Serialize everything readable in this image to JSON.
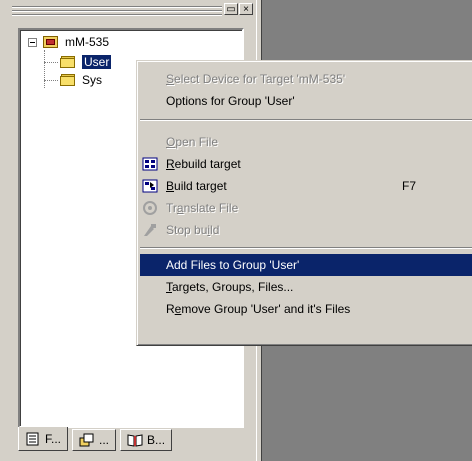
{
  "tree": {
    "root_label": "mM-535",
    "children": [
      {
        "label": "User",
        "selected": true
      },
      {
        "label": "Sys"
      }
    ]
  },
  "title_buttons": {
    "restore": "▭",
    "close": "×"
  },
  "tabs": [
    {
      "label": "F...",
      "icon": "files-icon"
    },
    {
      "label": "...",
      "icon": "regs-icon"
    },
    {
      "label": "B...",
      "icon": "books-icon"
    }
  ],
  "context_menu": {
    "items": [
      {
        "pre": "",
        "u": "S",
        "post": "elect Device for Target 'mM-535'",
        "accel": "",
        "enabled": false,
        "icon": ""
      },
      {
        "pre": "Options for Group 'User'",
        "u": "",
        "post": "",
        "accel": "",
        "enabled": true,
        "icon": ""
      },
      {
        "pre": "",
        "u": "O",
        "post": "pen File",
        "accel": "",
        "enabled": false,
        "icon": ""
      },
      {
        "pre": "",
        "u": "R",
        "post": "ebuild target",
        "accel": "",
        "enabled": true,
        "icon": "rebuild-icon"
      },
      {
        "pre": "",
        "u": "B",
        "post": "uild target",
        "accel": "F7",
        "enabled": true,
        "icon": "build-icon"
      },
      {
        "pre": "Tr",
        "u": "a",
        "post": "nslate File",
        "accel": "",
        "enabled": false,
        "icon": "translate-icon"
      },
      {
        "pre": "Stop bu",
        "u": "i",
        "post": "ld",
        "accel": "",
        "enabled": false,
        "icon": "stop-build-icon"
      },
      {
        "pre": "Add Files to Group 'User'",
        "u": "",
        "post": "",
        "accel": "",
        "enabled": true,
        "highlighted": true,
        "icon": ""
      },
      {
        "pre": "",
        "u": "T",
        "post": "argets, Groups, Files...",
        "accel": "",
        "enabled": true,
        "icon": ""
      },
      {
        "pre": "R",
        "u": "e",
        "post": "move Group 'User' and it's Files",
        "accel": "",
        "enabled": true,
        "icon": ""
      }
    ]
  }
}
